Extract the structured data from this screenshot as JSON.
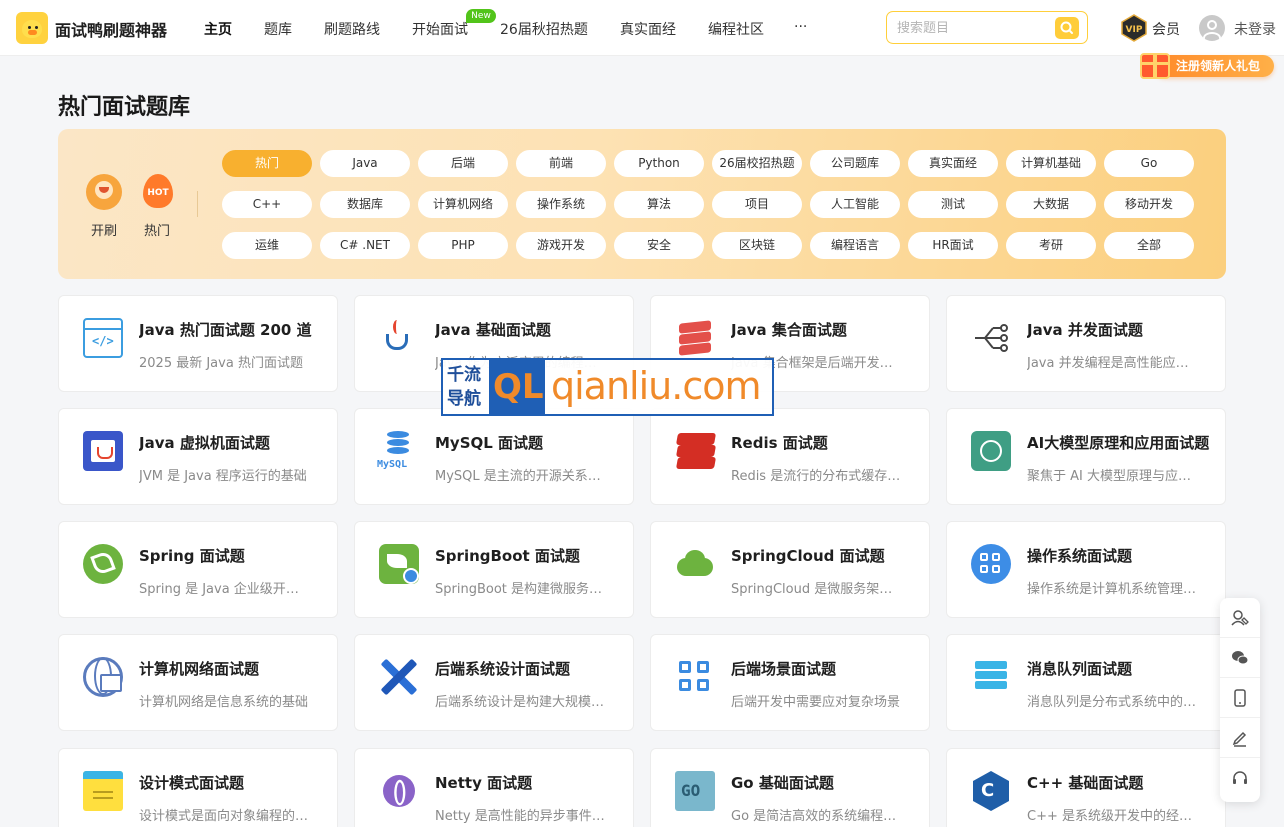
{
  "header": {
    "logo_text": "面试鸭刷题神器",
    "nav": [
      {
        "label": "主页",
        "active": true
      },
      {
        "label": "题库"
      },
      {
        "label": "刷题路线"
      },
      {
        "label": "开始面试",
        "badge": "New"
      },
      {
        "label": "26届秋招热题"
      },
      {
        "label": "真实面经"
      },
      {
        "label": "编程社区"
      },
      {
        "label": "···"
      }
    ],
    "search_placeholder": "搜索题目",
    "vip_label": "会员",
    "login_label": "未登录",
    "gift_text": "注册领新人礼包",
    "icons": {
      "search": "search-icon",
      "vip": "vip-crown-icon",
      "avatar": "user-avatar-icon",
      "gift": "gift-box-icon"
    }
  },
  "page_title": "热门面试题库",
  "quick_links": [
    {
      "label": "开刷",
      "icon": "start-brush-icon"
    },
    {
      "label": "热门",
      "icon": "hot-flame-icon",
      "icon_text": "HOT"
    }
  ],
  "tags": [
    [
      "热门",
      "Java",
      "后端",
      "前端",
      "Python",
      "26届校招热题",
      "公司题库",
      "真实面经",
      "计算机基础",
      "Go"
    ],
    [
      "C++",
      "数据库",
      "计算机网络",
      "操作系统",
      "算法",
      "项目",
      "人工智能",
      "测试",
      "大数据",
      "移动开发"
    ],
    [
      "运维",
      "C# .NET",
      "PHP",
      "游戏开发",
      "安全",
      "区块链",
      "编程语言",
      "HR面试",
      "考研",
      "全部"
    ]
  ],
  "active_tag": "热门",
  "cards": [
    {
      "title": "Java 热门面试题 200 道",
      "desc": "2025 最新 Java 热门面试题",
      "icon": "code-window-icon"
    },
    {
      "title": "Java 基础面试题",
      "desc": "Java 作为广泛应用的编程语言",
      "icon": "java-cup-icon"
    },
    {
      "title": "Java 集合面试题",
      "desc": "Java 集合框架是后端开发必备",
      "icon": "layers-icon"
    },
    {
      "title": "Java 并发面试题",
      "desc": "Java 并发编程是高性能应用的核心",
      "icon": "fork-branch-icon"
    },
    {
      "title": "Java 虚拟机面试题",
      "desc": "JVM 是 Java 程序运行的基础",
      "icon": "jvm-icon"
    },
    {
      "title": "MySQL 面试题",
      "desc": "MySQL 是主流的开源关系型数据库",
      "icon": "mysql-database-icon",
      "icon_text": "MySQL"
    },
    {
      "title": "Redis 面试题",
      "desc": "Redis 是流行的分布式缓存数据库",
      "icon": "redis-icon"
    },
    {
      "title": "AI大模型原理和应用面试题",
      "desc": "聚焦于 AI 大模型原理与应用实践",
      "icon": "openai-icon"
    },
    {
      "title": "Spring 面试题",
      "desc": "Spring 是 Java 企业级开发框架",
      "icon": "spring-leaf-icon"
    },
    {
      "title": "SpringBoot 面试题",
      "desc": "SpringBoot 是构建微服务的利器",
      "icon": "springboot-icon"
    },
    {
      "title": "SpringCloud 面试题",
      "desc": "SpringCloud 是微服务架构的解决方案",
      "icon": "springcloud-icon"
    },
    {
      "title": "操作系统面试题",
      "desc": "操作系统是计算机系统管理的核心",
      "icon": "os-windows-icon"
    },
    {
      "title": "计算机网络面试题",
      "desc": "计算机网络是信息系统的基础",
      "icon": "globe-network-icon"
    },
    {
      "title": "后端系统设计面试题",
      "desc": "后端系统设计是构建大规模系统的关键",
      "icon": "design-tools-icon"
    },
    {
      "title": "后端场景面试题",
      "desc": "后端开发中需要应对复杂场景",
      "icon": "grid-apps-icon"
    },
    {
      "title": "消息队列面试题",
      "desc": "消息队列是分布式系统中的重要组件",
      "icon": "message-queue-icon"
    },
    {
      "title": "设计模式面试题",
      "desc": "设计模式是面向对象编程的经验总结",
      "icon": "notepad-icon"
    },
    {
      "title": "Netty 面试题",
      "desc": "Netty 是高性能的异步事件驱动框架",
      "icon": "netty-icon"
    },
    {
      "title": "Go 基础面试题",
      "desc": "Go 是简洁高效的系统编程语言",
      "icon": "go-icon",
      "icon_text": "GO"
    },
    {
      "title": "C++ 基础面试题",
      "desc": "C++ 是系统级开发中的经典语言",
      "icon": "cpp-icon",
      "icon_text": "C"
    }
  ],
  "watermark": {
    "cn_line1": "千流",
    "cn_line2": "导航",
    "badge": "QL",
    "domain": "qianliu.com"
  },
  "toolbar": [
    {
      "icon": "ai-assistant-icon"
    },
    {
      "icon": "wechat-icon"
    },
    {
      "icon": "mobile-phone-icon"
    },
    {
      "icon": "edit-pen-icon"
    },
    {
      "icon": "headset-support-icon"
    }
  ],
  "colors": {
    "accent": "#ffd23f",
    "active_tag": "#f8b02f",
    "new_badge": "#52c41a",
    "gift": "#ff8a2a",
    "card_border": "#ececec"
  }
}
